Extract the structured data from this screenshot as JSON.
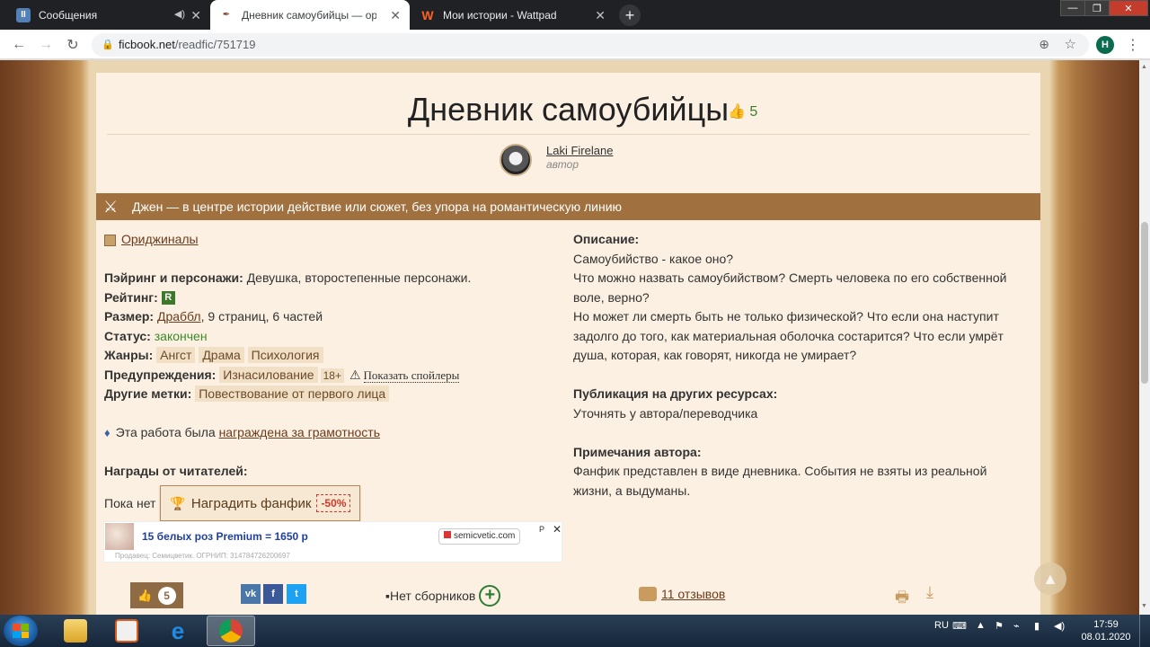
{
  "browser": {
    "tabs": [
      {
        "title": "Сообщения",
        "icon": "vk-messages-icon",
        "favicon_letter": "II",
        "favicon_color": "#5181b8"
      },
      {
        "title": "Дневник самоубийцы — ориджинал",
        "icon": "ficbook-quill-icon",
        "favicon_letter": "✒",
        "favicon_color": "#8a3a2a"
      },
      {
        "title": "Мои истории - Wattpad",
        "icon": "wattpad-icon",
        "favicon_letter": "W",
        "favicon_color": "#ff6122"
      }
    ],
    "new_tab": "+",
    "url_host": "ficbook.net",
    "url_path": "/readfic/751719",
    "profile_letter": "H",
    "win_controls": [
      "—",
      "❐",
      "✕"
    ]
  },
  "work": {
    "title": "Дневник самоубийцы",
    "likes": "5",
    "author": {
      "name": "Laki Firelane",
      "role": "автор"
    },
    "direction": "Джен — в центре истории действие или сюжет, без упора на романтическую линию",
    "fandom": "Ориджиналы",
    "pairing_label": "Пэйринг и персонажи:",
    "pairing_value": "Девушка, второстепенные персонажи.",
    "rating_label": "Рейтинг:",
    "rating_value": "R",
    "size_label": "Размер:",
    "size_link": "Драббл",
    "size_rest": ", 9 страниц, 6 частей",
    "status_label": "Статус:",
    "status_value": "закончен",
    "genres_label": "Жанры:",
    "genres": [
      "Ангст",
      "Драма",
      "Психология"
    ],
    "warnings_label": "Предупреждения:",
    "warning_tag": "Изнасилование",
    "warning_age": "18+",
    "show_spoilers": "Показать спойлеры",
    "other_tags_label": "Другие метки:",
    "other_tag": "Повествование от первого лица",
    "grammar_text": "Эта работа была",
    "grammar_link": "награждена за грамотность",
    "reader_awards_label": "Награды от читателей:",
    "reader_awards_none": "Пока нет",
    "award_button": "Наградить фанфик",
    "award_discount": "-50%"
  },
  "description": {
    "label": "Описание:",
    "lines": [
      "Самоубийство - какое оно?",
      "Что можно назвать самоубийством? Смерть человека по его собственной",
      "воле, верно?",
      "Но может ли смерть быть не только физической? Что если она наступит",
      "задолго до того, как материальная оболочка состарится? Что если умрёт",
      "душа, которая, как говорят, никогда не умирает?"
    ],
    "publication_label": "Публикация на других ресурсах:",
    "publication_value": "Уточнять у автора/переводчика",
    "notes_label": "Примечания автора:",
    "notes_lines": [
      "Фанфик представлен в виде дневника. События не взяты из реальной",
      "жизни, а выдуманы."
    ]
  },
  "ad": {
    "title": "15 белых роз Premium = 1650 р",
    "domain": "semicvetic.com",
    "mark": "Р",
    "close": "✕",
    "seller": "Продавец: Семицветик. ОГРНИП: 314784726200697"
  },
  "bottom": {
    "likes": "5",
    "social": [
      "vk",
      "f",
      "t"
    ],
    "collections": "Нет сборников",
    "reviews": "11 отзывов"
  },
  "taskbar": {
    "lang": "RU",
    "time": "17:59",
    "date": "08.01.2020"
  }
}
